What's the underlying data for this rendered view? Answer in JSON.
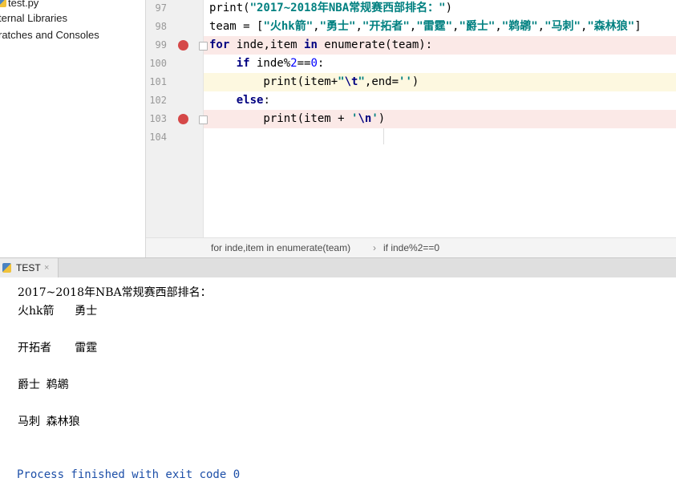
{
  "sidebar": {
    "items": [
      {
        "label": "test.py",
        "icon": "python-file-icon"
      },
      {
        "label": "ternal Libraries"
      },
      {
        "label": "ratches and Consoles"
      }
    ]
  },
  "editor": {
    "lines": [
      {
        "num": "97",
        "code": [
          {
            "t": "print(",
            "c": ""
          },
          {
            "t": "\"2017~2018年NBA常规赛西部排名：\"",
            "c": "str"
          },
          {
            "t": ")",
            "c": ""
          }
        ]
      },
      {
        "num": "98",
        "code": [
          {
            "t": "team = [",
            "c": ""
          },
          {
            "t": "\"火hk箭\"",
            "c": "str"
          },
          {
            "t": ",",
            "c": ""
          },
          {
            "t": "\"勇士\"",
            "c": "str"
          },
          {
            "t": ",",
            "c": ""
          },
          {
            "t": "\"开拓者\"",
            "c": "str"
          },
          {
            "t": ",",
            "c": ""
          },
          {
            "t": "\"雷霆\"",
            "c": "str"
          },
          {
            "t": ",",
            "c": ""
          },
          {
            "t": "\"爵士\"",
            "c": "str"
          },
          {
            "t": ",",
            "c": ""
          },
          {
            "t": "\"鹈鹕\"",
            "c": "str"
          },
          {
            "t": ",",
            "c": ""
          },
          {
            "t": "\"马刺\"",
            "c": "str"
          },
          {
            "t": ",",
            "c": ""
          },
          {
            "t": "\"森林狼\"",
            "c": "str"
          },
          {
            "t": "]",
            "c": ""
          }
        ]
      },
      {
        "num": "99",
        "breakpoint": true,
        "code": [
          {
            "t": "for",
            "c": "kw"
          },
          {
            "t": " inde,item ",
            "c": ""
          },
          {
            "t": "in",
            "c": "kw"
          },
          {
            "t": " enumerate(team):",
            "c": ""
          }
        ]
      },
      {
        "num": "100",
        "code": [
          {
            "t": "    ",
            "c": ""
          },
          {
            "t": "if",
            "c": "kw"
          },
          {
            "t": " inde%",
            "c": ""
          },
          {
            "t": "2",
            "c": "num"
          },
          {
            "t": "==",
            "c": ""
          },
          {
            "t": "0",
            "c": "num"
          },
          {
            "t": ":",
            "c": ""
          }
        ]
      },
      {
        "num": "101",
        "current": true,
        "code": [
          {
            "t": "        print(item+",
            "c": ""
          },
          {
            "t": "\"",
            "c": "str"
          },
          {
            "t": "\\t",
            "c": "esc"
          },
          {
            "t": "\"",
            "c": "str"
          },
          {
            "t": ",",
            "c": ""
          },
          {
            "t": "end=",
            "c": ""
          },
          {
            "t": "''",
            "c": "str"
          },
          {
            "t": ")",
            "c": ""
          }
        ]
      },
      {
        "num": "102",
        "code": [
          {
            "t": "    ",
            "c": ""
          },
          {
            "t": "else",
            "c": "kw"
          },
          {
            "t": ":",
            "c": ""
          }
        ]
      },
      {
        "num": "103",
        "breakpoint": true,
        "code": [
          {
            "t": "        print(item + ",
            "c": ""
          },
          {
            "t": "'",
            "c": "str"
          },
          {
            "t": "\\n",
            "c": "esc"
          },
          {
            "t": "'",
            "c": "str"
          },
          {
            "t": ")",
            "c": ""
          }
        ]
      },
      {
        "num": "104",
        "code": []
      }
    ]
  },
  "breadcrumb": {
    "items": [
      "for inde,item in enumerate(team)",
      "if inde%2==0"
    ],
    "separator": "›"
  },
  "run": {
    "tab_label": "TEST",
    "close_glyph": "×",
    "console_lines": [
      "2017~2018年NBA常规赛西部排名：",
      "火hk箭\t勇士",
      "开拓者\t雷霆",
      "爵士\t鹈鹕",
      "马刺\t森林狼"
    ],
    "exit_message": "Process finished with exit code 0"
  },
  "colors": {
    "breakpoint": "#d54848",
    "breakpoint_line_bg": "#fbe9e7",
    "current_line_bg": "#fdf8e0",
    "keyword": "#000080",
    "string": "#008080",
    "number": "#0000ff",
    "exit_text": "#1d4fa8"
  }
}
